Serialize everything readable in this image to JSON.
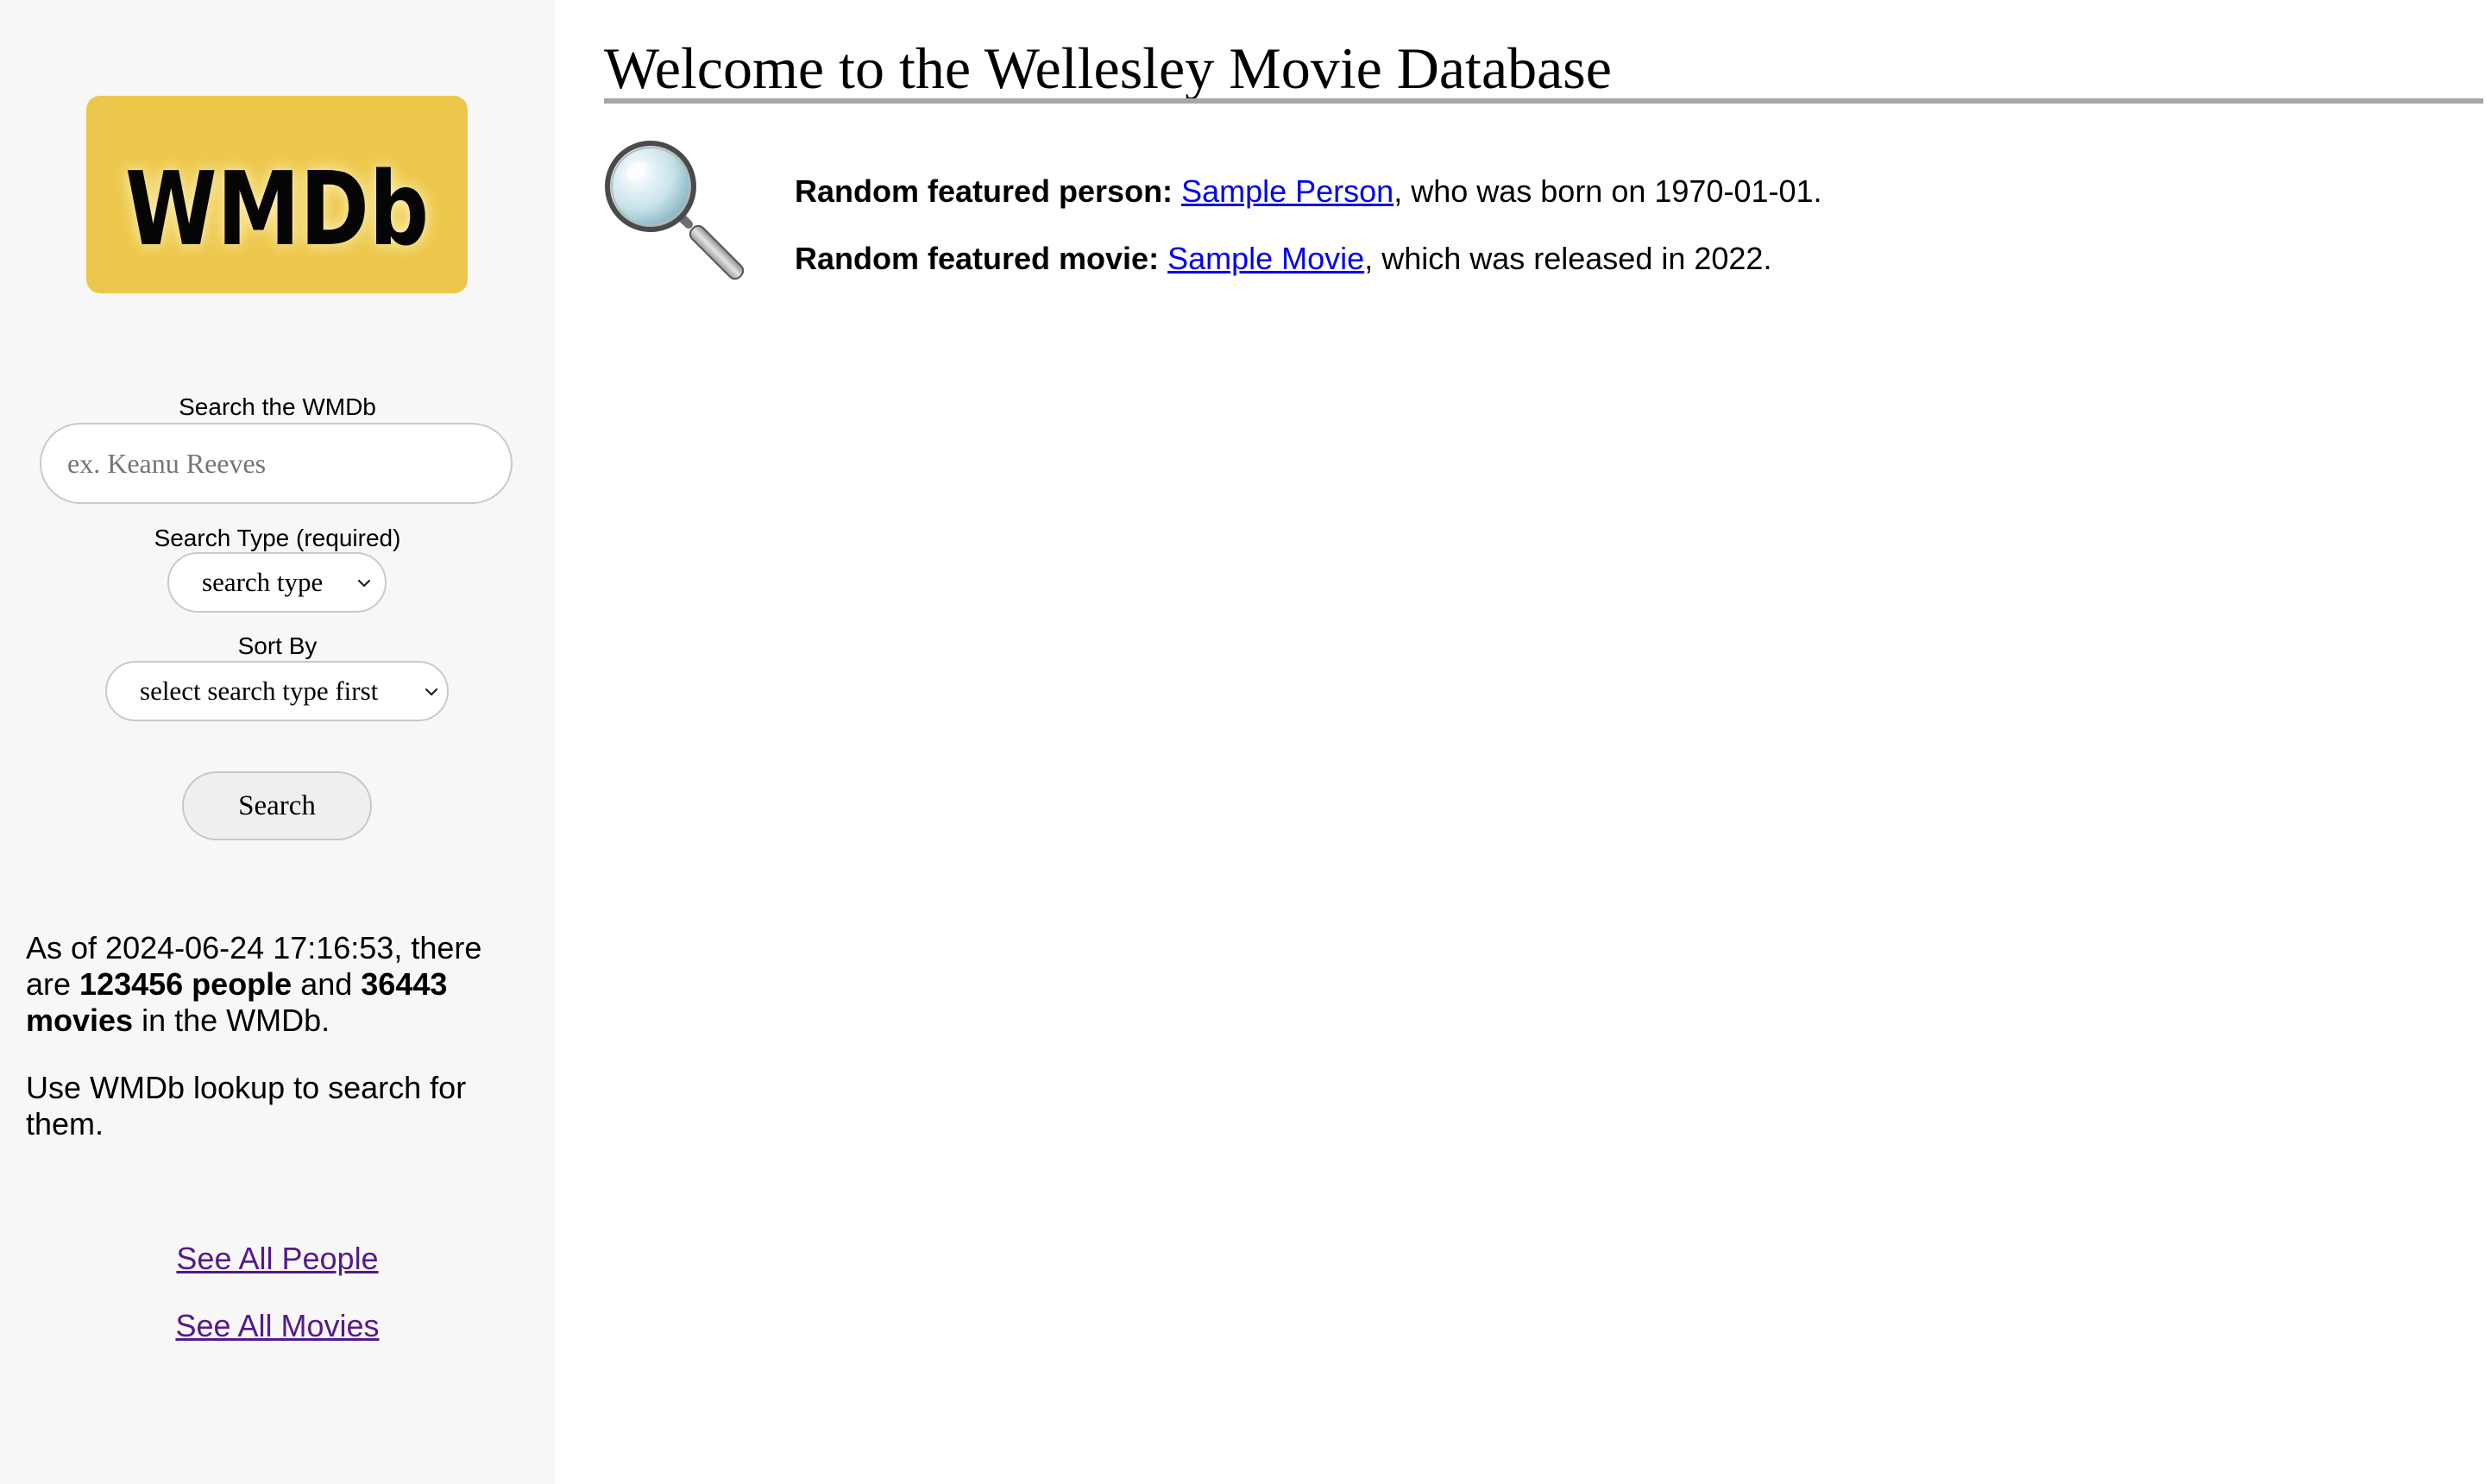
{
  "sidebar": {
    "logo_text": "WMDb",
    "search_label": "Search the WMDb",
    "search_placeholder": "ex. Keanu Reeves",
    "search_type_label": "Search Type (required)",
    "search_type_value": "search type",
    "sort_by_label": "Sort By",
    "sort_by_value": "select search type first",
    "search_button": "Search",
    "stats": {
      "prefix": "As of ",
      "timestamp": "2024-06-24 17:16:53",
      "mid1": ", there are ",
      "people_count": "123456 people",
      "mid2": " and ",
      "movie_count": "36443 movies",
      "suffix": " in the WMDb."
    },
    "lookup_text": "Use WMDb lookup to search for them.",
    "links": {
      "people": "See All People",
      "movies": "See All Movies"
    }
  },
  "main": {
    "title": "Welcome to the Wellesley Movie Database",
    "featured_person": {
      "label": "Random featured person:",
      "name": "Sample Person",
      "text": ", who was born on 1970-01-01."
    },
    "featured_movie": {
      "label": "Random featured movie:",
      "name": "Sample Movie",
      "text": ", which was released in 2022."
    }
  },
  "colors": {
    "sidebar_bg": "#f7f7f7",
    "logo_bg": "#ecc74b",
    "link": "#0000ee",
    "visited_link": "#551a8b",
    "title_rule": "#a6a6a6"
  },
  "icons": [
    "magnifying-glass-icon",
    "chevron-down-icon"
  ]
}
